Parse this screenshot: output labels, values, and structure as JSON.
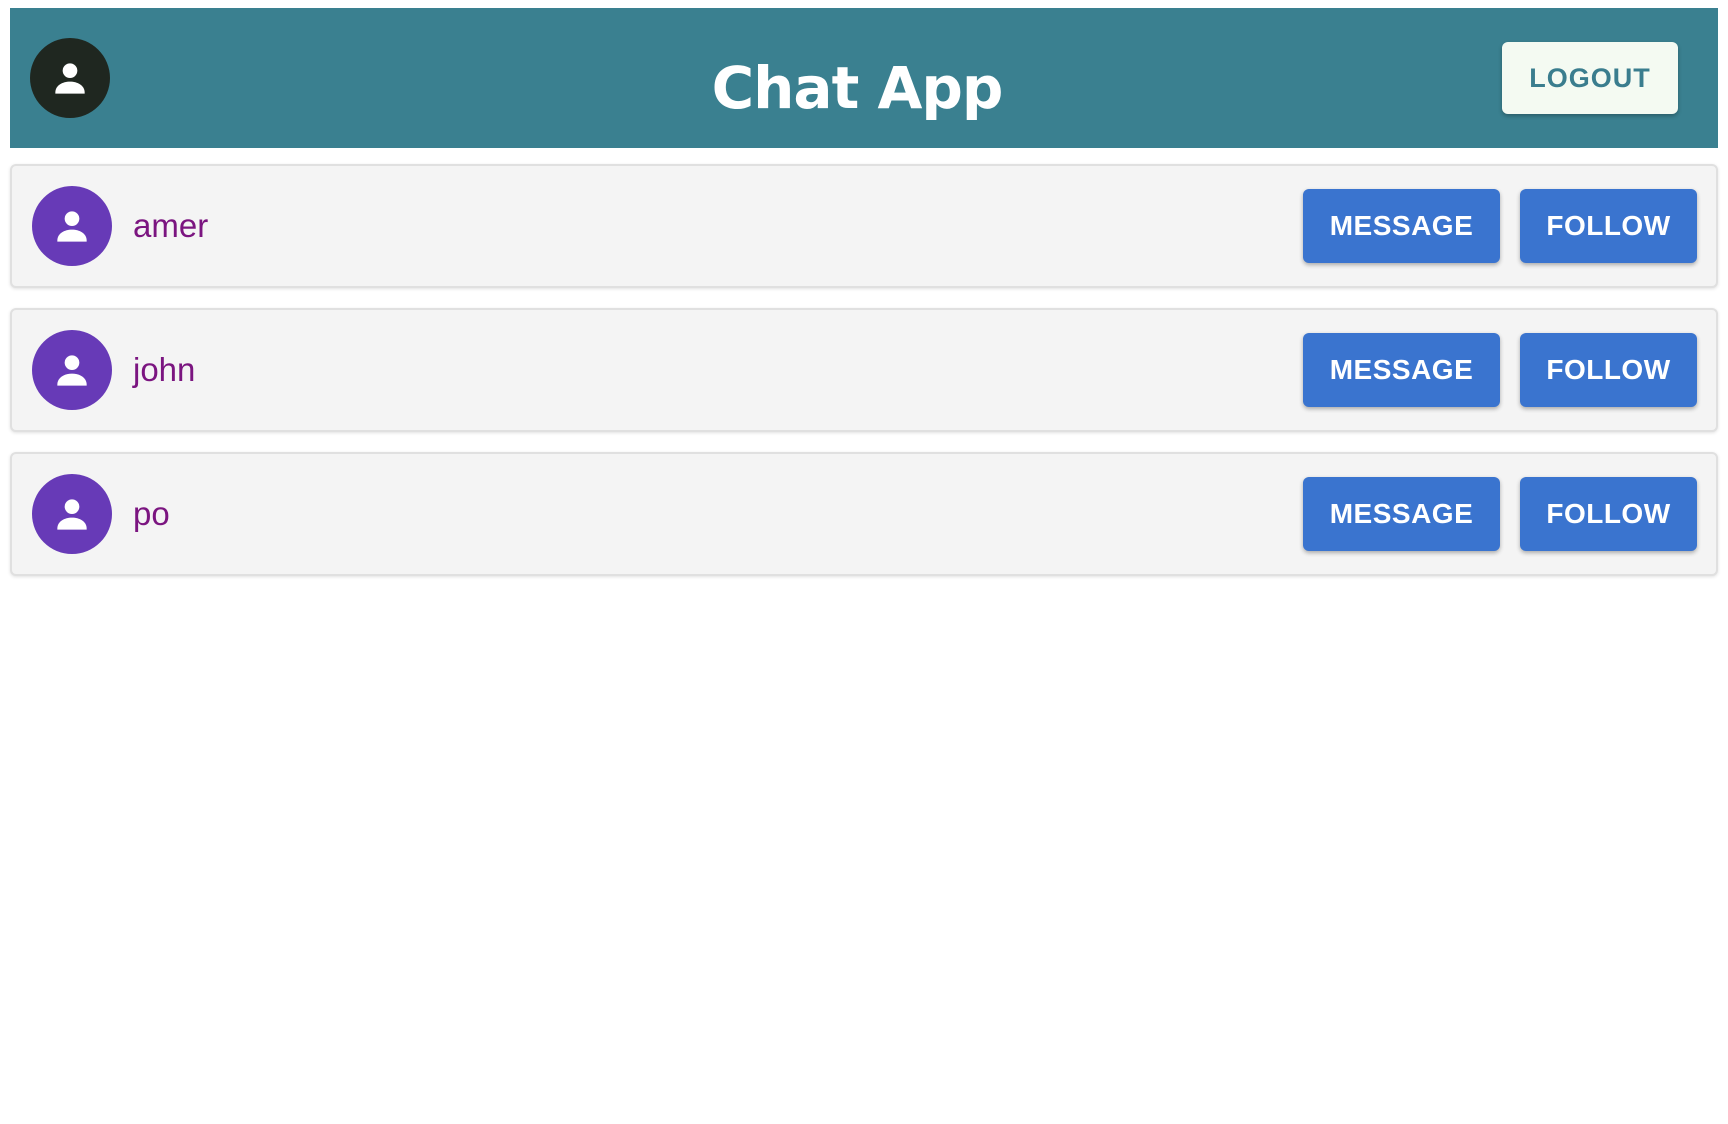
{
  "header": {
    "title": "Chat App",
    "logout_label": "LOGOUT",
    "avatar_icon": "person-icon"
  },
  "users": [
    {
      "name": "amer",
      "message_label": "MESSAGE",
      "follow_label": "FOLLOW"
    },
    {
      "name": "john",
      "message_label": "MESSAGE",
      "follow_label": "FOLLOW"
    },
    {
      "name": "po",
      "message_label": "MESSAGE",
      "follow_label": "FOLLOW"
    }
  ],
  "colors": {
    "app_bar": "#3a8090",
    "header_avatar": "#1f2720",
    "user_avatar": "#673ab7",
    "user_name": "#7b1580",
    "action_button": "#3a74cf",
    "logout_button_bg": "#f4faf2",
    "logout_button_text": "#3a7d8e",
    "card_background": "#f4f4f4"
  }
}
